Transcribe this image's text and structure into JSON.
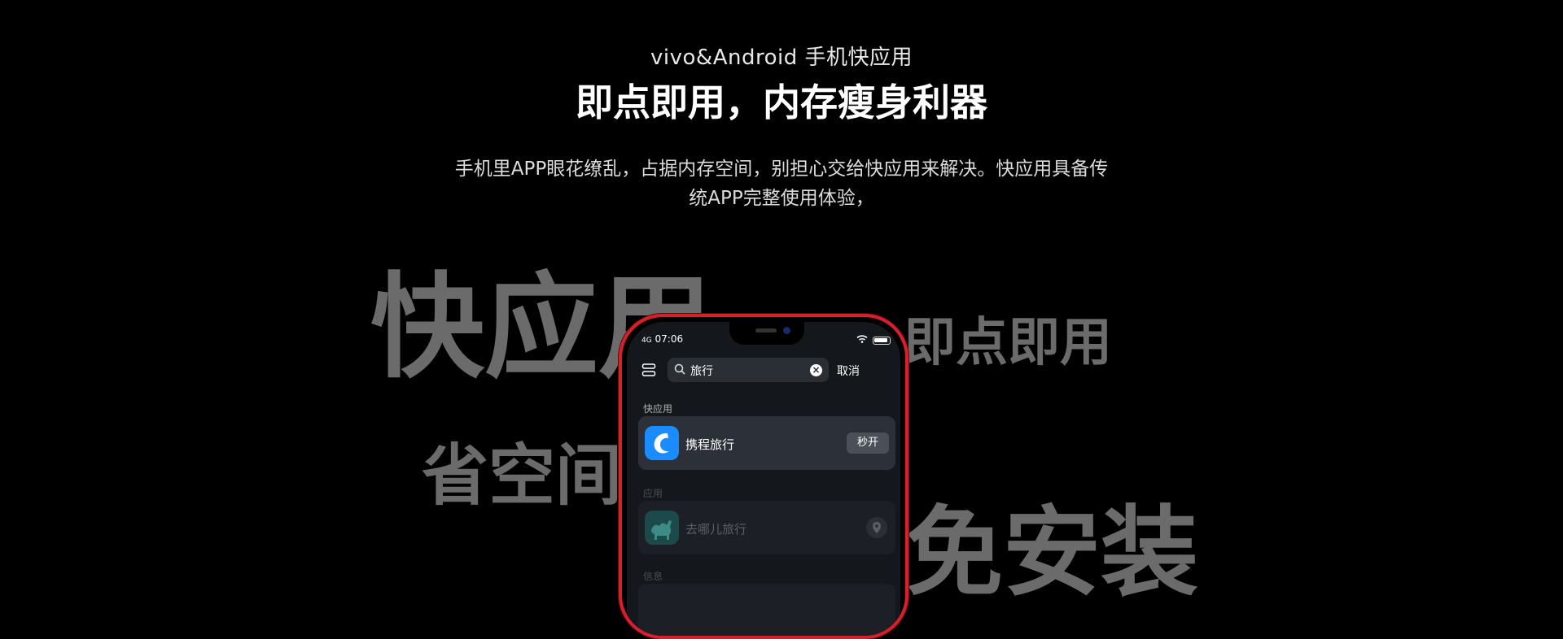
{
  "header": {
    "subtitle": "vivo&Android  手机快应用",
    "title": "即点即用，内存瘦身利器",
    "description": "手机里APP眼花缭乱，占据内存空间，别担心交给快应用来解决。快应用具备传统APP完整使用体验，"
  },
  "feature_words": [
    "快应用",
    "即点即用",
    "省空间",
    "免安装"
  ],
  "phone": {
    "status_time": "07:06",
    "network": "4G",
    "search_query": "旅行",
    "cancel_label": "取消",
    "sections": {
      "quick_apps": "快应用",
      "apps": "应用",
      "info": "信息"
    },
    "quick_app": {
      "name": "携程旅行",
      "button": "秒开"
    },
    "app": {
      "name": "去哪儿旅行"
    }
  },
  "colors": {
    "frame": "#d91f2a",
    "brand_blue": "#1a8cff"
  }
}
